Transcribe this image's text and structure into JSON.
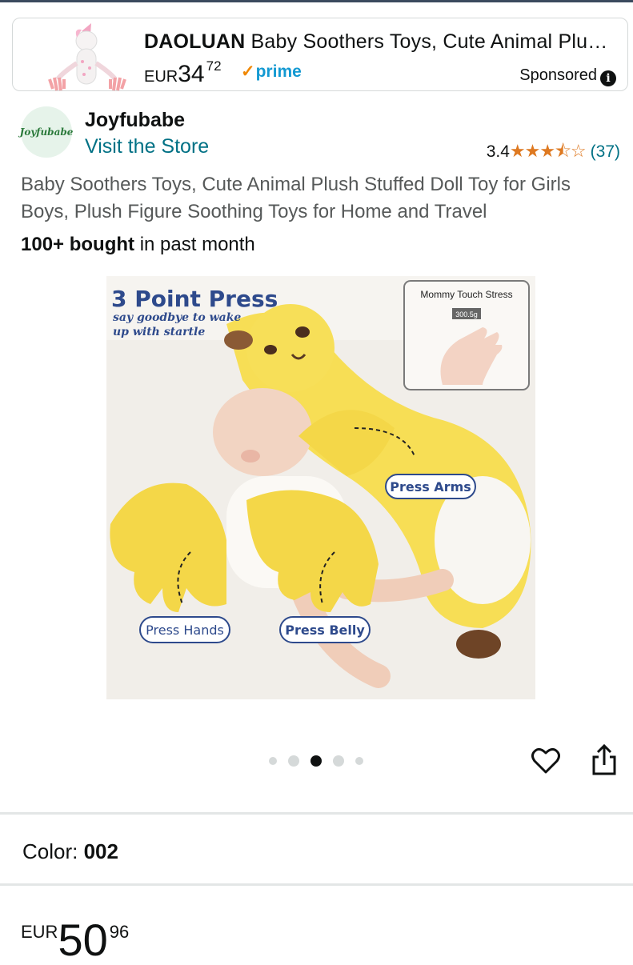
{
  "sponsored_ad": {
    "brand": "DAOLUAN",
    "title": "Baby Soothers Toys, Cute Animal Plu…",
    "currency": "EUR",
    "price_whole": "34",
    "price_fraction": "72",
    "prime_label": "prime",
    "sponsored_label": "Sponsored"
  },
  "store": {
    "logo_text": "Joyfubabe",
    "name": "Joyfubabe",
    "visit_label": "Visit the Store",
    "rating": "3.4",
    "stars": "★★★⯪☆",
    "review_count": "(37)"
  },
  "product": {
    "title": "Baby Soothers Toys, Cute Animal Plush Stuffed Doll Toy for Girls Boys, Plush Figure Soothing Toys for Home and Travel",
    "bought_bold": "100+ bought",
    "bought_rest": " in past month"
  },
  "product_image": {
    "headline": "3 Point Press",
    "subline_1": "say goodbye to wake",
    "subline_2": "up with startle",
    "inset_title": "Mommy Touch Stress",
    "inset_scale": "300.5g",
    "label_arms": "Press Arms",
    "label_hands": "Press Hands",
    "label_belly": "Press Belly"
  },
  "carousel": {
    "total": 5,
    "active_index": 2
  },
  "variation": {
    "color_label": "Color: ",
    "color_value": "002"
  },
  "price": {
    "currency": "EUR",
    "whole": "50",
    "fraction": "96"
  },
  "colors": {
    "link": "#007185",
    "star": "#de7921",
    "prime": "#1399d2"
  }
}
